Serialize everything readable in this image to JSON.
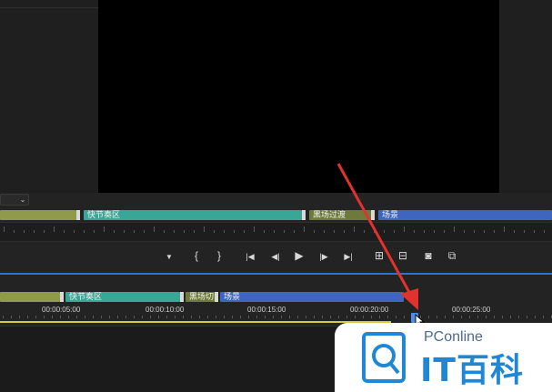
{
  "upper_markers": [
    {
      "label": "",
      "color": "#8f9a4a"
    },
    {
      "label": "快节奏区",
      "color": "#3aa695"
    },
    {
      "label": "黑场过渡",
      "color": "#6e7a3c"
    },
    {
      "label": "场景",
      "color": "#3f66bf"
    }
  ],
  "lower_markers": [
    {
      "label": "",
      "color": "#8f9a4a"
    },
    {
      "label": "快节奏区",
      "color": "#3aa695"
    },
    {
      "label": "黑场切",
      "color": "#6e7a3c"
    },
    {
      "label": "场景",
      "color": "#3f66bf"
    }
  ],
  "timecodes": [
    "00:00:05:00",
    "00:00:10:00",
    "00:00:15:00",
    "00:00:20:00",
    "00:00:25:00"
  ],
  "transport": {
    "add_marker": "▼",
    "mark_in": "{",
    "mark_out": "}",
    "go_to_in": "|◀",
    "step_back": "◀|",
    "play": "▶",
    "step_forward": "|▶",
    "go_to_out": "▶|",
    "insert": "⊞",
    "overwrite": "⊟",
    "export_frame": "◙",
    "button_editor": "⧉"
  },
  "dropdown_icon": "chevron-down-icon",
  "watermark": {
    "brand": "PConline",
    "name": "IT百科"
  },
  "colors": {
    "accent_blue": "#2b73d3",
    "playhead": "#4c8fe8",
    "work_area": "#d8c74a",
    "arrow": "#e0332e"
  }
}
